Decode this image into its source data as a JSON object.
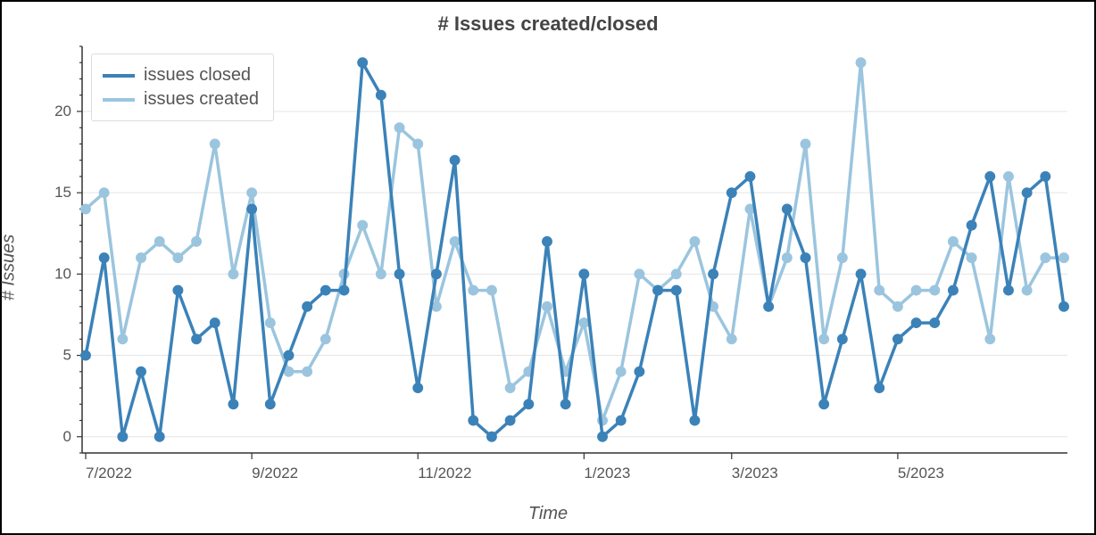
{
  "chart_data": {
    "type": "line",
    "title": "# Issues created/closed",
    "xlabel": "Time",
    "ylabel": "# Issues",
    "ylim": [
      -1,
      24
    ],
    "y_ticks": [
      0,
      5,
      10,
      15,
      20
    ],
    "x_tick_labels": [
      "7/2022",
      "9/2022",
      "11/2022",
      "1/2023",
      "3/2023",
      "5/2023"
    ],
    "x_tick_indices": [
      0,
      9,
      18,
      27,
      35,
      44
    ],
    "n_points": 53,
    "series": [
      {
        "name": "issues closed",
        "color": "#3B82B8",
        "values": [
          5,
          11,
          0,
          4,
          0,
          9,
          6,
          7,
          2,
          14,
          2,
          5,
          8,
          9,
          9,
          23,
          21,
          10,
          3,
          10,
          17,
          1,
          0,
          1,
          2,
          12,
          2,
          10,
          0,
          1,
          4,
          9,
          9,
          1,
          10,
          15,
          16,
          8,
          14,
          11,
          2,
          6,
          10,
          3,
          6,
          7,
          7,
          9,
          13,
          16,
          9,
          15,
          16,
          8
        ]
      },
      {
        "name": "issues created",
        "color": "#9BC5DE",
        "values": [
          14,
          15,
          6,
          11,
          12,
          11,
          12,
          18,
          10,
          15,
          7,
          4,
          4,
          6,
          10,
          13,
          10,
          19,
          18,
          8,
          12,
          9,
          9,
          3,
          4,
          8,
          4,
          7,
          1,
          4,
          10,
          9,
          10,
          12,
          8,
          6,
          14,
          8,
          11,
          18,
          6,
          11,
          23,
          9,
          8,
          9,
          9,
          12,
          11,
          6,
          16,
          9,
          11,
          11
        ]
      }
    ],
    "legend": {
      "closed": "issues closed",
      "created": "issues created"
    }
  }
}
